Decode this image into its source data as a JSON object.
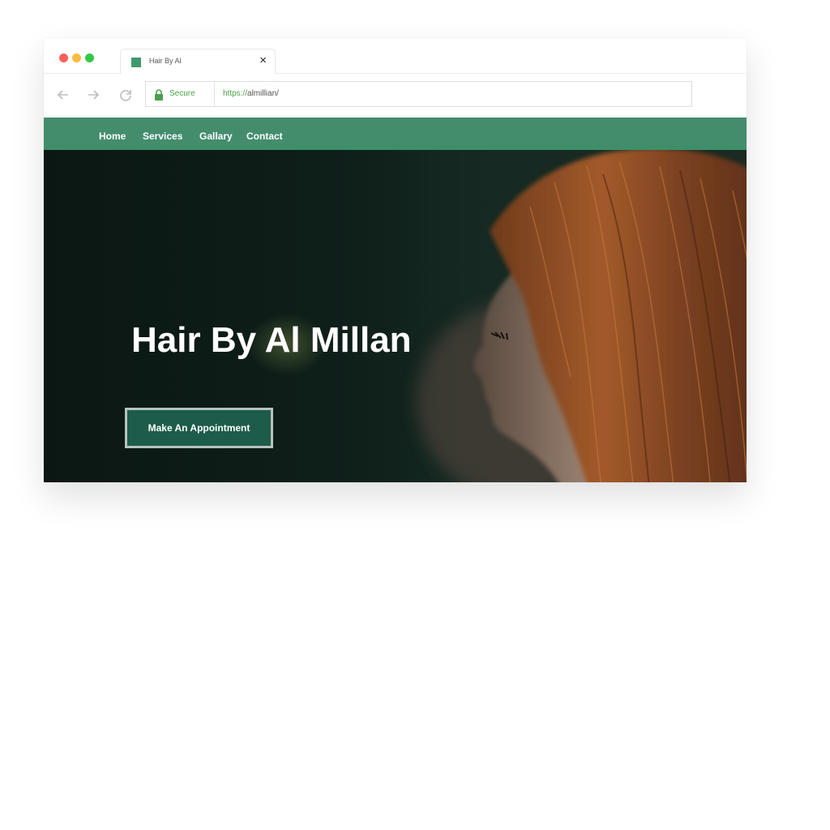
{
  "browser": {
    "tab_title": "Hair By Al",
    "tab_close": "×",
    "secure_label": "Secure",
    "url_scheme": "https://",
    "url_rest": "almillian/"
  },
  "nav": {
    "items": [
      {
        "label": "Home"
      },
      {
        "label": "Services"
      },
      {
        "label": "Gallary"
      },
      {
        "label": "Contact"
      }
    ]
  },
  "hero": {
    "title": "Hair By Al Millan",
    "cta_label": "Make An Appointment"
  },
  "colors": {
    "brand_green": "#438d6d",
    "button_green": "#1d5c4a",
    "secure_green": "#4aa24a"
  }
}
